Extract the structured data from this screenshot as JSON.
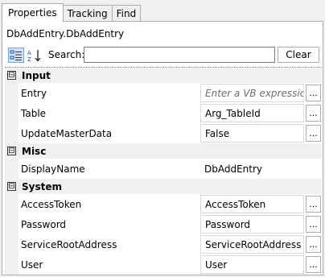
{
  "tabs": [
    {
      "label": "Properties"
    },
    {
      "label": "Tracking"
    },
    {
      "label": "Find"
    }
  ],
  "title": "DbAddEntry.DbAddEntry",
  "toolbar": {
    "categorized_icon": "categorized-icon",
    "alphabetical_icon": "sort-alphabetical-icon",
    "search_label": "Search:",
    "search_value": "",
    "clear_label": "Clear"
  },
  "expander_symbol": "⊟",
  "ellipsis": "...",
  "categories": [
    {
      "name": "Input",
      "properties": [
        {
          "name": "Entry",
          "value": "",
          "placeholder": "Enter a VB expression"
        },
        {
          "name": "Table",
          "value": "Arg_TableId"
        },
        {
          "name": "UpdateMasterData",
          "value": "False"
        }
      ]
    },
    {
      "name": "Misc",
      "properties": [
        {
          "name": "DisplayName",
          "value": "DbAddEntry"
        }
      ]
    },
    {
      "name": "System",
      "properties": [
        {
          "name": "AccessToken",
          "value": "AccessToken"
        },
        {
          "name": "Password",
          "value": "Password"
        },
        {
          "name": "ServiceRootAddress",
          "value": "ServiceRootAddress"
        },
        {
          "name": "User",
          "value": "User"
        }
      ]
    }
  ]
}
